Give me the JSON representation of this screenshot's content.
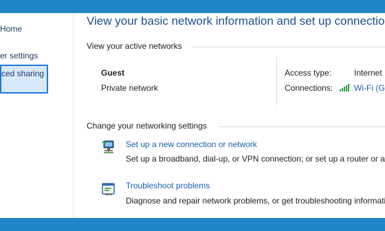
{
  "sidebar": {
    "items": [
      {
        "label": "Home"
      },
      {
        "label": "er settings"
      },
      {
        "label": "ced sharing"
      }
    ]
  },
  "main": {
    "title": "View your basic network information and set up connections",
    "active_networks": {
      "header": "View your active networks",
      "network_name": "Guest",
      "network_type": "Private network",
      "access_type_label": "Access type:",
      "access_type_value": "Internet",
      "connections_label": "Connections:",
      "connections_value": "Wi-Fi (G"
    },
    "settings": {
      "header": "Change your networking settings",
      "tasks": [
        {
          "icon": "new-connection-icon",
          "link": "Set up a new connection or network",
          "description": "Set up a broadband, dial-up, or VPN connection; or set up a router or access point."
        },
        {
          "icon": "troubleshoot-icon",
          "link": "Troubleshoot problems",
          "description": "Diagnose and repair network problems, or get troubleshooting information."
        }
      ]
    }
  },
  "colors": {
    "window_border": "#1f86c8",
    "link": "#1a5fb4",
    "title": "#1f4e8c",
    "wifi": "#2a9d3a",
    "selection_fill": "#d7e9fa",
    "selection_border": "#1e7ad6"
  }
}
